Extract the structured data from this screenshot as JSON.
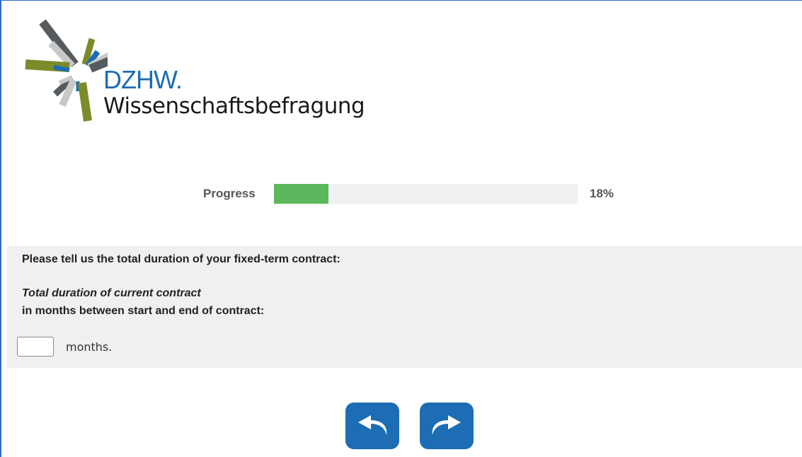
{
  "logo": {
    "brand": "DZHW.",
    "subtitle": "Wissenschaftsbefragung"
  },
  "progress": {
    "label": "Progress",
    "percent": 18,
    "value_text": "18%",
    "fill_color": "#5cb85c",
    "track_color": "#f0f0f0"
  },
  "question": {
    "text": "Please tell us the total duration of your fixed-term contract:",
    "item_title": "Total duration of current contract",
    "item_subtitle": "in months between start and end of contract:",
    "input_value": "",
    "unit": "months."
  },
  "navigation": {
    "back_icon": "back-arrow-icon",
    "next_icon": "forward-arrow-icon",
    "button_color": "#1c6db3"
  },
  "colors": {
    "frame_border": "#2f6bc5",
    "question_background": "#f0f0f0",
    "brand_blue": "#1c6db3"
  }
}
